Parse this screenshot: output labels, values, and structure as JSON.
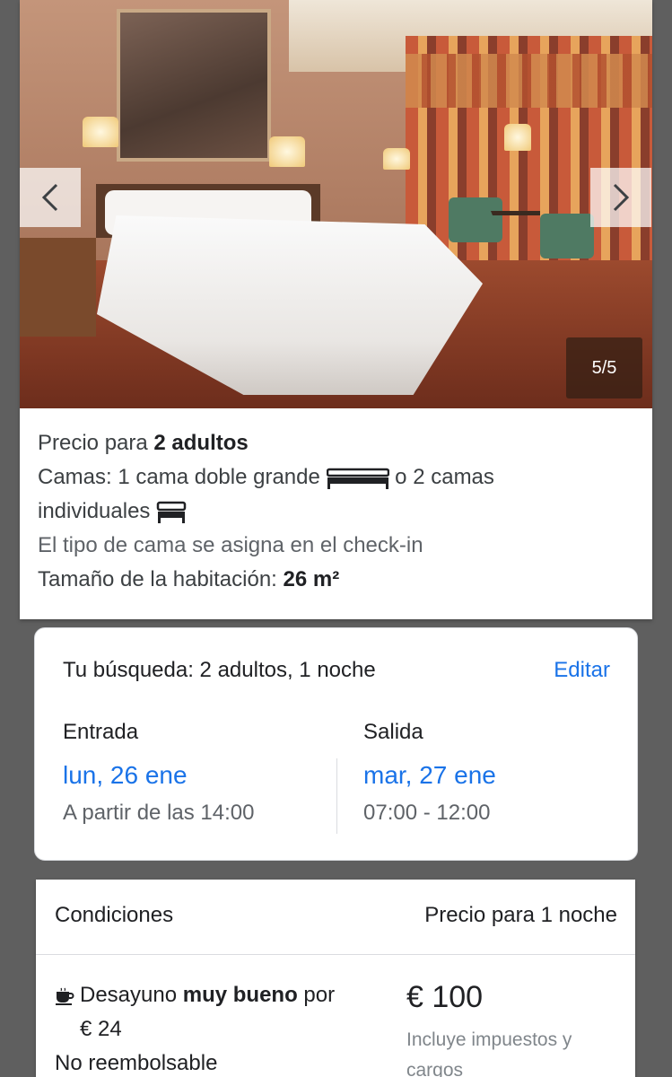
{
  "gallery": {
    "counter": "5/5",
    "prev_icon": "chevron-left-icon",
    "next_icon": "chevron-right-icon"
  },
  "room": {
    "price_for_prefix": "Precio para ",
    "price_for_value": "2 adultos",
    "beds_prefix": "Camas:  1 cama doble grande ",
    "beds_or": " o 2 camas",
    "beds_individual": "individuales ",
    "bed_note": "El tipo de cama se asigna en el check-in",
    "size_prefix": "Tamaño de la habitación: ",
    "size_value": "26 m²"
  },
  "search": {
    "summary": "Tu búsqueda: 2 adultos, 1 noche",
    "edit_label": "Editar",
    "checkin": {
      "label": "Entrada",
      "date": "lun, 26 ene",
      "time": "A partir de las 14:00"
    },
    "checkout": {
      "label": "Salida",
      "date": "mar, 27 ene",
      "time": "07:00 - 12:00"
    }
  },
  "rate": {
    "conditions_header": "Condiciones",
    "price_header": "Precio para 1 noche",
    "breakfast_prefix": "Desayuno ",
    "breakfast_quality": "muy bueno",
    "breakfast_suffix": " por",
    "breakfast_price": "€ 24",
    "refund_policy": "No reembolsable",
    "price": "€ 100",
    "price_note": "Incluye impuestos y cargos"
  },
  "colors": {
    "link": "#1a73e8",
    "muted": "#5f6368"
  }
}
